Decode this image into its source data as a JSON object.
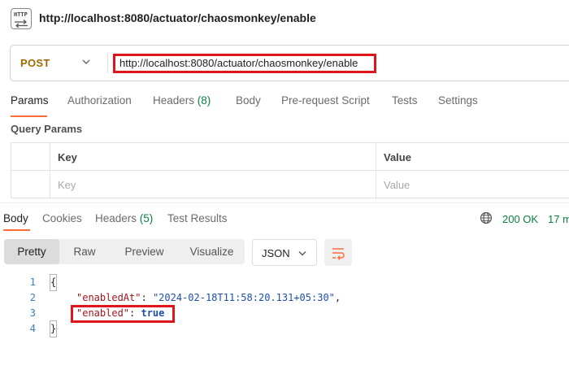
{
  "window": {
    "title": "http://localhost:8080/actuator/chaosmonkey/enable",
    "icon_text": "HTTP"
  },
  "request": {
    "method": "POST",
    "url": "http://localhost:8080/actuator/chaosmonkey/enable"
  },
  "request_tabs": [
    {
      "label": "Params",
      "active": true
    },
    {
      "label": "Authorization"
    },
    {
      "label": "Headers",
      "count": "(8)"
    },
    {
      "label": "Body"
    },
    {
      "label": "Pre-request Script"
    },
    {
      "label": "Tests"
    },
    {
      "label": "Settings"
    }
  ],
  "query_params": {
    "title": "Query Params",
    "columns": [
      "Key",
      "Value"
    ],
    "placeholders": {
      "key": "Key",
      "value": "Value"
    }
  },
  "response_tabs": [
    {
      "label": "Body",
      "active": true
    },
    {
      "label": "Cookies"
    },
    {
      "label": "Headers",
      "count": "(5)"
    },
    {
      "label": "Test Results"
    }
  ],
  "response_status": {
    "status": "200 OK",
    "time": "17 m"
  },
  "format_options": [
    {
      "label": "Pretty",
      "active": true
    },
    {
      "label": "Raw"
    },
    {
      "label": "Preview"
    },
    {
      "label": "Visualize"
    }
  ],
  "language_select": {
    "value": "JSON"
  },
  "response_body": {
    "line_numbers": [
      "1",
      "2",
      "3",
      "4"
    ],
    "open_brace": "{",
    "close_brace": "}",
    "fields": [
      {
        "key": "\"enabledAt\"",
        "value": "\"2024-02-18T11:58:20.131+05:30\"",
        "trail": ","
      },
      {
        "key": "\"enabled\"",
        "value": "true",
        "trail": ""
      }
    ]
  },
  "colors": {
    "accent": "#ff6c37",
    "method": "#a06a00",
    "status_ok": "#0a7f3f",
    "highlight": "#e0151b",
    "json_key": "#a3151c",
    "json_value": "#1e4fa8"
  }
}
